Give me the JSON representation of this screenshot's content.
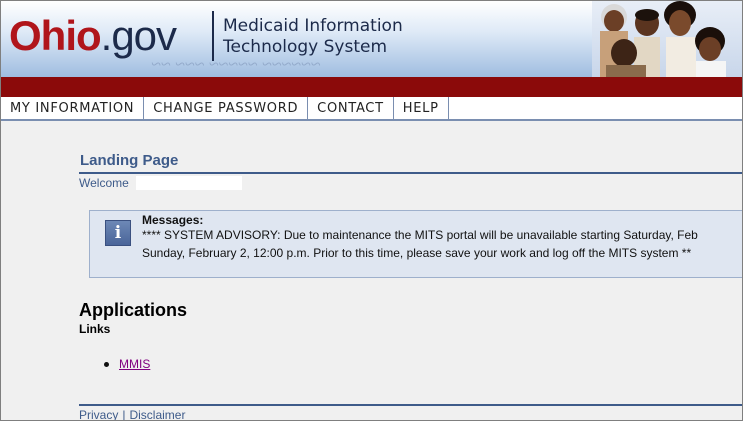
{
  "header": {
    "logo_ohio": "Ohio",
    "logo_gov": ".gov",
    "system_name_line1": "Medicaid Information",
    "system_name_line2": "Technology System"
  },
  "nav": {
    "items": [
      {
        "label": "MY INFORMATION"
      },
      {
        "label": "CHANGE PASSWORD"
      },
      {
        "label": "CONTACT"
      },
      {
        "label": "HELP"
      }
    ]
  },
  "main": {
    "page_title": "Landing Page",
    "welcome_label": "Welcome",
    "messages": {
      "heading": "Messages:",
      "line1": "**** SYSTEM ADVISORY: Due to maintenance the MITS portal will be unavailable starting Saturday, Feb",
      "line2": "Sunday, February 2, 12:00 p.m. Prior to this time, please save your work and log off the MITS system **"
    },
    "applications_title": "Applications",
    "links_label": "Links",
    "links": [
      {
        "label": "MMIS"
      }
    ]
  },
  "footer": {
    "privacy": "Privacy",
    "separator": "|",
    "disclaimer": "Disclaimer"
  },
  "colors": {
    "brand_red": "#8b0a0a",
    "link_blue": "#3e5b8a",
    "visited_link": "#800080",
    "message_bg": "#dfe6f1"
  }
}
